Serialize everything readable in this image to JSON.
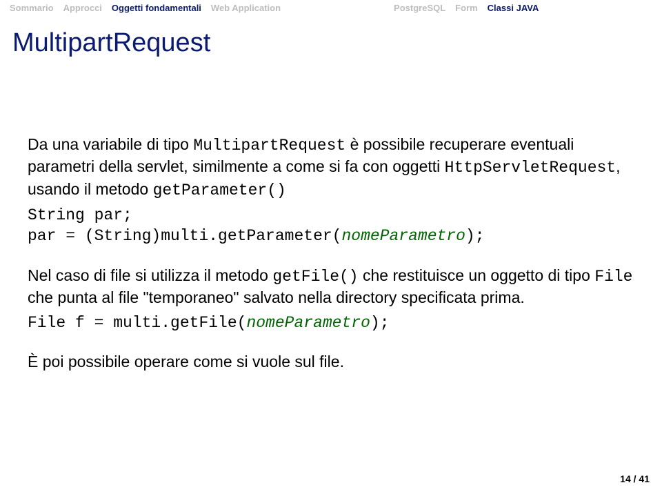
{
  "nav": {
    "left": [
      {
        "label": "Sommario",
        "state": "dim"
      },
      {
        "label": "Approcci",
        "state": "dim"
      },
      {
        "label": "Oggetti fondamentali",
        "state": "active-section"
      },
      {
        "label": "Web Application",
        "state": "dim"
      }
    ],
    "right": [
      {
        "label": "PostgreSQL",
        "state": "dim"
      },
      {
        "label": "Form",
        "state": "dim"
      },
      {
        "label": "Classi JAVA",
        "state": "active-sub"
      }
    ]
  },
  "title": "MultipartRequest",
  "para1_a": "Da una variabile di tipo ",
  "para1_code1": "MultipartRequest",
  "para1_b": " è possibile recuperare eventuali parametri della servlet, similmente a come si fa con oggetti ",
  "para1_code2": "HttpServletRequest",
  "para1_c": ", usando il metodo ",
  "para1_code3": "getParameter()",
  "code1_line1": "String par;",
  "code1_line2a": "par = (String)multi.getParameter(",
  "code1_line2_emph": "nomeParametro",
  "code1_line2b": ");",
  "para2_a": "Nel caso di file si utilizza il metodo ",
  "para2_code1": "getFile()",
  "para2_b": " che restituisce un oggetto di tipo ",
  "para2_code2": "File",
  "para2_c": " che punta al file \"temporaneo\" salvato nella directory specificata prima.",
  "code2_a": "File f = multi.getFile(",
  "code2_emph": "nomeParametro",
  "code2_b": ");",
  "para3": "È poi possibile operare come si vuole sul file.",
  "page_number": "14 / 41"
}
